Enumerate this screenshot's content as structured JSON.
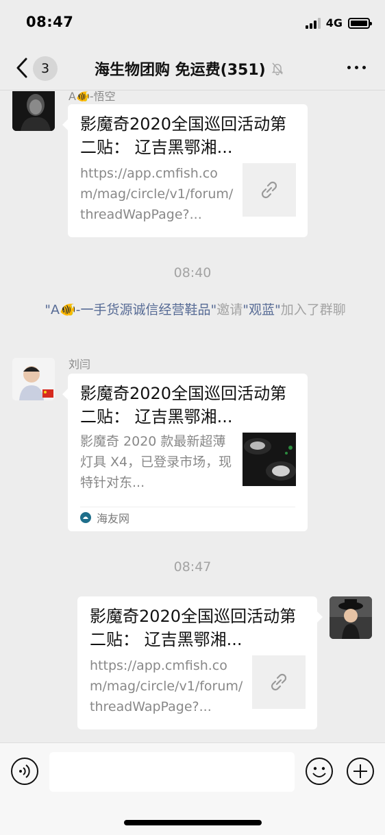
{
  "status_bar": {
    "time": "08:47",
    "network": "4G"
  },
  "nav": {
    "back_count": "3",
    "title": "海生物团购  免运费(351)"
  },
  "messages": [
    {
      "sender": "A🐠-悟空",
      "title": "影魔奇2020全国巡回活动第二贴： 辽吉黑鄂湘...",
      "desc": "https://app.cmfish.com/mag/circle/v1/forum/threadWapPage?...",
      "thumb": "link-icon"
    },
    {
      "type": "time",
      "text": "08:40"
    },
    {
      "type": "system",
      "prefix": "\"A🐠-一手货源诚信经营鞋品\"",
      "verb": "邀请",
      "target": "\"观蓝\"",
      "suffix": "加入了群聊"
    },
    {
      "sender": "刘闫",
      "title": "影魔奇2020全国巡回活动第二贴： 辽吉黑鄂湘...",
      "desc": "影魔奇 2020 款最新超薄灯具 X4，已登录市场，现特针对东...",
      "thumb": "product-image",
      "source": "海友网"
    },
    {
      "type": "time",
      "text": "08:47"
    },
    {
      "sender": "",
      "title": "影魔奇2020全国巡回活动第二贴： 辽吉黑鄂湘...",
      "desc": "https://app.cmfish.com/mag/circle/v1/forum/threadWapPage?...",
      "thumb": "link-icon"
    }
  ],
  "icons": {
    "back": "chevron-left-icon",
    "mute": "bell-slash-icon",
    "more": "more-dots-icon",
    "voice": "voice-icon",
    "emoji": "smiley-icon",
    "plus": "plus-icon",
    "source": "haiyou-logo-icon"
  },
  "colors": {
    "background": "#EDEDED",
    "card": "#FFFFFF",
    "link": "#576B95",
    "muted_text": "#A3A3A3"
  }
}
